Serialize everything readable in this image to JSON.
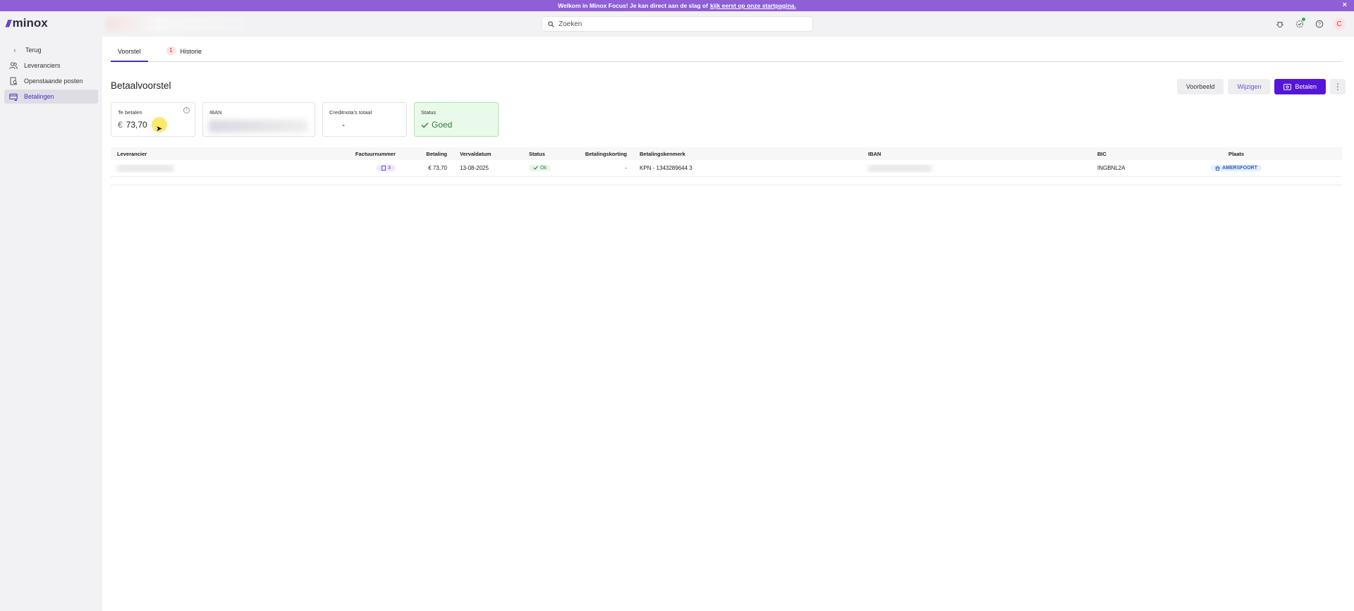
{
  "banner": {
    "text": "Welkom in Minox Focus! Je kan direct aan de slag of",
    "link": "kijk eerst op onze startpagina.",
    "close": "×"
  },
  "app": {
    "logo_text": "minox"
  },
  "search": {
    "placeholder": "Zoeken"
  },
  "user": {
    "initial": "C"
  },
  "sidebar": {
    "items": [
      {
        "label": "Terug",
        "icon": "chevron-left-icon"
      },
      {
        "label": "Leveranciers",
        "icon": "users-icon"
      },
      {
        "label": "Openstaande posten",
        "icon": "document-search-icon"
      },
      {
        "label": "Betalingen",
        "icon": "payments-icon",
        "active": true
      }
    ]
  },
  "tabs": [
    {
      "label": "Voorstel",
      "active": true
    },
    {
      "label": "Historie",
      "badge": "1"
    }
  ],
  "page": {
    "title": "Betaalvoorstel"
  },
  "actions": {
    "preview": "Voorbeeld",
    "edit": "Wijzigen",
    "pay": "Betalen",
    "more": "⋮"
  },
  "cards": {
    "to_pay": {
      "label": "Te betalen",
      "currency": "€",
      "value": "73,70"
    },
    "iban": {
      "label": "IBAN",
      "value": ""
    },
    "credit": {
      "label": "Creditnota's totaal",
      "value": "-"
    },
    "status": {
      "label": "Status",
      "value": "Goed"
    }
  },
  "table": {
    "headers": [
      "Leverancier",
      "Factuurnummer",
      "Betaling",
      "Vervaldatum",
      "Status",
      "Betalingskorting",
      "Betalingskenmerk",
      "IBAN",
      "BIC",
      "Plaats"
    ],
    "rows": [
      {
        "supplier": "",
        "invoice_count": "3",
        "amount": "€ 73,70",
        "due_date": "13-08-2025",
        "status": "Ok",
        "discount": "-",
        "reference": "KPN - 1343289644 3",
        "iban": "",
        "bic": "INGBNL2A",
        "city": "AMERSFOORT"
      }
    ]
  },
  "colors": {
    "banner": "#8e5fd6",
    "primary": "#5516d8",
    "ok_green": "#2e7d3a"
  }
}
